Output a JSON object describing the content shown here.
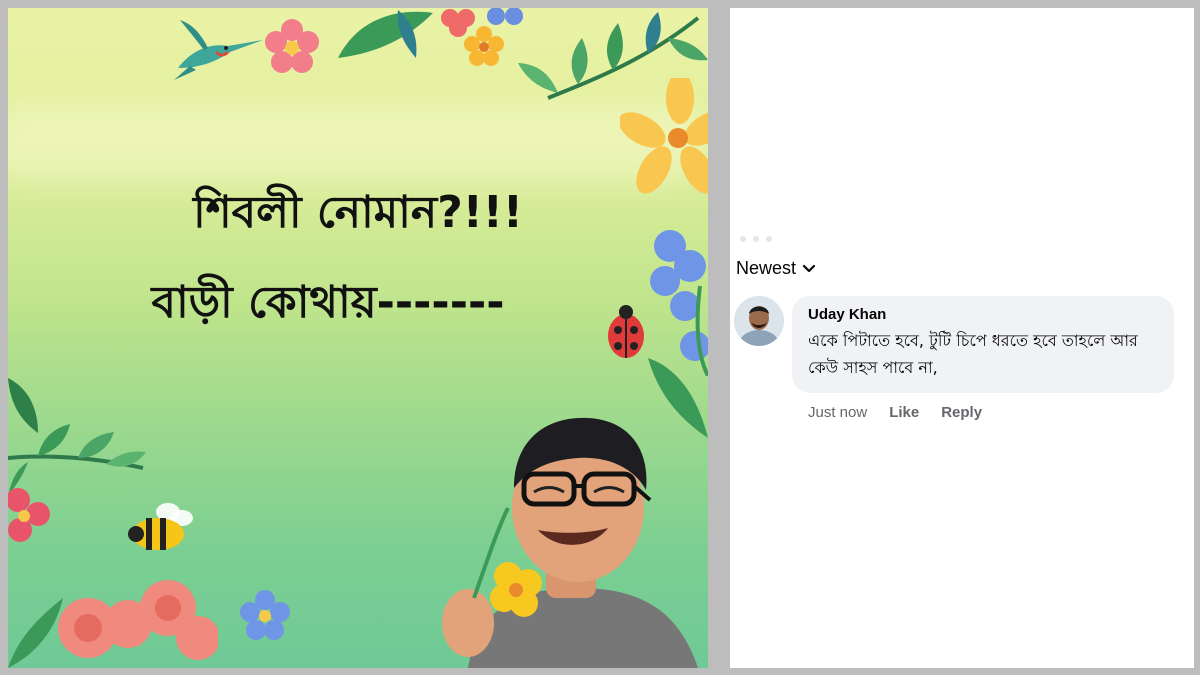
{
  "post_image": {
    "headline_line1": "শিবলী নোমান?!!!",
    "headline_line2": "বাড়ী কোথায়-------",
    "decorations": [
      "hummingbird-icon",
      "flower-icon",
      "leaf-icon",
      "ladybug-icon",
      "bee-icon",
      "avatar-character"
    ]
  },
  "comments_section": {
    "sort_label": "Newest",
    "sort_icon": "chevron-down-icon",
    "comment": {
      "author": "Uday Khan",
      "text": "একে পিটাতে হবে, টুটি চিপে ধরতে হবে তাহলে আর কেউ সাহস পাবে না,",
      "timestamp": "Just now",
      "like_label": "Like",
      "reply_label": "Reply"
    }
  },
  "colors": {
    "bubble_bg": "#f0f2f5",
    "meta_text": "#65676b",
    "divider": "#bdbdbd"
  }
}
